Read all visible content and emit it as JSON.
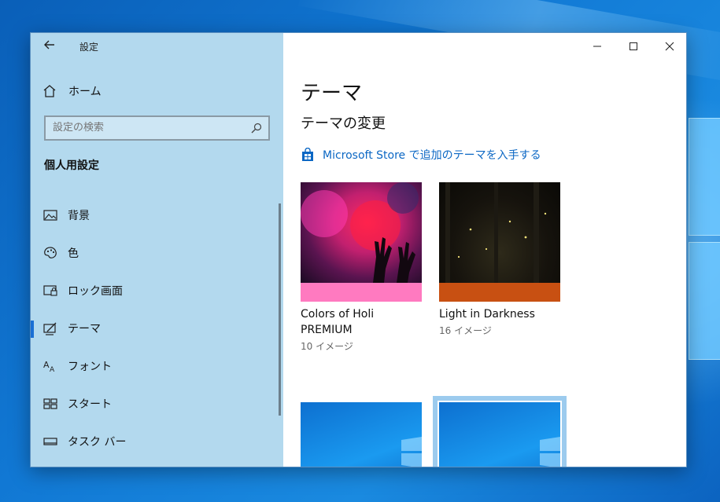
{
  "app": {
    "title": "設定"
  },
  "sidebar": {
    "home_label": "ホーム",
    "search_placeholder": "設定の検索",
    "section_title": "個人用設定",
    "items": [
      {
        "label": "背景",
        "icon": "picture-icon"
      },
      {
        "label": "色",
        "icon": "palette-icon"
      },
      {
        "label": "ロック画面",
        "icon": "lock-screen-icon"
      },
      {
        "label": "テーマ",
        "icon": "theme-brush-icon",
        "selected": true
      },
      {
        "label": "フォント",
        "icon": "font-icon"
      },
      {
        "label": "スタート",
        "icon": "start-icon"
      },
      {
        "label": "タスク バー",
        "icon": "taskbar-icon"
      }
    ]
  },
  "main": {
    "title": "テーマ",
    "subtitle": "テーマの変更",
    "store_link": "Microsoft Store で追加のテーマを入手する",
    "themes": [
      {
        "name": "Colors of Holi PREMIUM",
        "count": "10 イメージ",
        "accent": "#ff7ac0"
      },
      {
        "name": "Light in Darkness",
        "count": "16 イメージ",
        "accent": "#c85012"
      },
      {
        "name": "",
        "count": "",
        "accent": ""
      },
      {
        "name": "",
        "count": "",
        "accent": ""
      }
    ]
  },
  "colors": {
    "sidebar_bg": "#b3d9ee",
    "link": "#0b67c4",
    "selected_indicator": "#1a6fd4"
  }
}
